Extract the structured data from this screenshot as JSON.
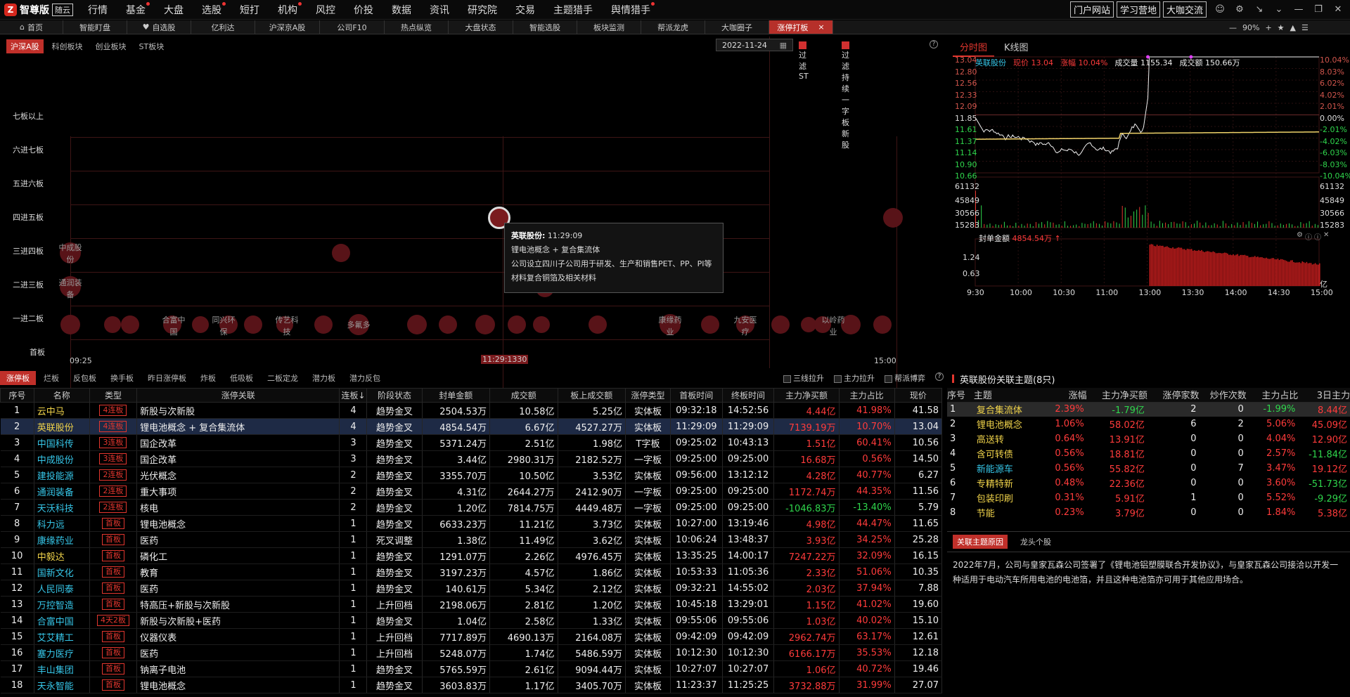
{
  "menubar": {
    "brand": "智尊版",
    "brand_tag": "随云",
    "items": [
      {
        "label": "行情",
        "dot": false
      },
      {
        "label": "基金",
        "dot": true
      },
      {
        "label": "大盘",
        "dot": false
      },
      {
        "label": "选股",
        "dot": true
      },
      {
        "label": "短打",
        "dot": false
      },
      {
        "label": "机构",
        "dot": true
      },
      {
        "label": "风控",
        "dot": false
      },
      {
        "label": "价投",
        "dot": false
      },
      {
        "label": "数据",
        "dot": false
      },
      {
        "label": "资讯",
        "dot": false
      },
      {
        "label": "研究院",
        "dot": false
      },
      {
        "label": "交易",
        "dot": false
      },
      {
        "label": "主题猎手",
        "dot": false
      },
      {
        "label": "舆情猎手",
        "dot": true
      }
    ],
    "right_buttons": [
      "门户网站",
      "学习营地",
      "大咖交流"
    ]
  },
  "tabs": [
    {
      "label": "首页",
      "icon": "home-icon",
      "active": false
    },
    {
      "label": "智能盯盘",
      "active": false
    },
    {
      "label": "自选股",
      "icon": "heart-icon",
      "active": false
    },
    {
      "label": "亿利达",
      "active": false
    },
    {
      "label": "沪深京A股",
      "active": false
    },
    {
      "label": "公司F10",
      "active": false
    },
    {
      "label": "热点纵览",
      "active": false
    },
    {
      "label": "大盘状态",
      "active": false
    },
    {
      "label": "智能选股",
      "active": false
    },
    {
      "label": "板块监测",
      "active": false
    },
    {
      "label": "帮派龙虎",
      "active": false
    },
    {
      "label": "大咖圈子",
      "active": false
    },
    {
      "label": "涨停打板",
      "active": true
    }
  ],
  "zoom": "90%",
  "limit_panel": {
    "tabs": [
      "沪深A股",
      "科创板块",
      "创业板块",
      "ST板块"
    ],
    "date": "2022-11-24",
    "filter_st": "过滤ST",
    "filter_one": "过滤持续一字板新股",
    "rows": [
      "七板以上",
      "六进七板",
      "五进六板",
      "四进五板",
      "三进四板",
      "二进三板",
      "一进二板",
      "首板"
    ],
    "bubble_names": [
      "中成股份",
      "通润装备",
      "合富中国",
      "同兴环保",
      "传艺科技",
      "多氟多",
      "康缘药业",
      "九安医疗",
      "以岭药业"
    ],
    "time_start": "09:25",
    "time_cursor": "11:29:13",
    "time_cursor_tail": "30",
    "time_end": "15:00",
    "tooltip": {
      "name": "英联股份:",
      "time": "11:29:09",
      "concept": "锂电池概念 + 复合集流体",
      "desc": "公司设立四川子公司用于研发、生产和销售PET、PP、PI等材料复合铜箔及相关材料"
    }
  },
  "table_tabs": [
    "涨停板",
    "烂板",
    "反包板",
    "换手板",
    "昨日涨停板",
    "炸板",
    "低吸板",
    "二板定龙",
    "潜力板",
    "潜力反包"
  ],
  "table_filters": [
    "三线拉升",
    "主力拉升",
    "帮派博弈"
  ],
  "table_headers": [
    "序号",
    "名称",
    "类型",
    "涨停关联",
    "连板↓",
    "阶段状态",
    "封单金额",
    "成交额",
    "板上成交额",
    "涨停类型",
    "首板时间",
    "终板时间",
    "主力净买额",
    "主力占比",
    "现价"
  ],
  "rows": [
    {
      "n": "1",
      "name": "云中马",
      "type": "4连板",
      "rel": "新股与次新股",
      "lb": "4",
      "stage": "趋势金叉",
      "fd": "2504.53万",
      "cje": "10.58亿",
      "bs": "5.25亿",
      "zt": "实体板",
      "t1": "09:32:18",
      "t2": "14:52:56",
      "jm": "4.44亿",
      "zb": "41.98%",
      "px": "41.58",
      "nc": "yl",
      "jc": "rd",
      "zc": "rd"
    },
    {
      "n": "2",
      "name": "英联股份",
      "type": "4连板",
      "rel": "锂电池概念 + 复合集流体",
      "lb": "4",
      "stage": "趋势金叉",
      "fd": "4854.54万",
      "cje": "6.67亿",
      "bs": "4527.27万",
      "zt": "实体板",
      "t1": "11:29:09",
      "t2": "11:29:09",
      "jm": "7139.19万",
      "zb": "10.70%",
      "px": "13.04",
      "nc": "yl",
      "jc": "rd",
      "zc": "rd",
      "sel": true
    },
    {
      "n": "3",
      "name": "中国科传",
      "type": "3连板",
      "rel": "国企改革",
      "lb": "3",
      "stage": "趋势金叉",
      "fd": "5371.24万",
      "cje": "2.51亿",
      "bs": "1.98亿",
      "zt": "T字板",
      "t1": "09:25:02",
      "t2": "10:43:13",
      "jm": "1.51亿",
      "zb": "60.41%",
      "px": "10.56",
      "nc": "cy",
      "jc": "rd",
      "zc": "rd"
    },
    {
      "n": "4",
      "name": "中成股份",
      "type": "3连板",
      "rel": "国企改革",
      "lb": "3",
      "stage": "趋势金叉",
      "fd": "3.44亿",
      "cje": "2980.31万",
      "bs": "2182.52万",
      "zt": "一字板",
      "t1": "09:25:00",
      "t2": "09:25:00",
      "jm": "16.68万",
      "zb": "0.56%",
      "px": "14.50",
      "nc": "cy",
      "jc": "rd",
      "zc": "rd"
    },
    {
      "n": "5",
      "name": "建投能源",
      "type": "2连板",
      "rel": "光伏概念",
      "lb": "2",
      "stage": "趋势金叉",
      "fd": "3355.70万",
      "cje": "10.50亿",
      "bs": "3.53亿",
      "zt": "实体板",
      "t1": "09:56:00",
      "t2": "13:12:12",
      "jm": "4.28亿",
      "zb": "40.77%",
      "px": "6.27",
      "nc": "cy",
      "jc": "rd",
      "zc": "rd"
    },
    {
      "n": "6",
      "name": "通润装备",
      "type": "2连板",
      "rel": "重大事项",
      "lb": "2",
      "stage": "趋势金叉",
      "fd": "4.31亿",
      "cje": "2644.27万",
      "bs": "2412.90万",
      "zt": "一字板",
      "t1": "09:25:00",
      "t2": "09:25:00",
      "jm": "1172.74万",
      "zb": "44.35%",
      "px": "11.56",
      "nc": "cy",
      "jc": "rd",
      "zc": "rd"
    },
    {
      "n": "7",
      "name": "天沃科技",
      "type": "2连板",
      "rel": "核电",
      "lb": "2",
      "stage": "趋势金叉",
      "fd": "1.20亿",
      "cje": "7814.75万",
      "bs": "4449.48万",
      "zt": "一字板",
      "t1": "09:25:00",
      "t2": "09:25:00",
      "jm": "-1046.83万",
      "zb": "-13.40%",
      "px": "5.79",
      "nc": "cy",
      "jc": "gr",
      "zc": "gr"
    },
    {
      "n": "8",
      "name": "科力远",
      "type": "首板",
      "rel": "锂电池概念",
      "lb": "1",
      "stage": "趋势金叉",
      "fd": "6633.23万",
      "cje": "11.21亿",
      "bs": "3.73亿",
      "zt": "实体板",
      "t1": "10:27:00",
      "t2": "13:19:46",
      "jm": "4.98亿",
      "zb": "44.47%",
      "px": "11.65",
      "nc": "cy",
      "jc": "rd",
      "zc": "rd"
    },
    {
      "n": "9",
      "name": "康缘药业",
      "type": "首板",
      "rel": "医药",
      "lb": "1",
      "stage": "死叉调整",
      "fd": "1.38亿",
      "cje": "11.49亿",
      "bs": "3.62亿",
      "zt": "实体板",
      "t1": "10:06:24",
      "t2": "13:48:37",
      "jm": "3.93亿",
      "zb": "34.25%",
      "px": "25.28",
      "nc": "cy",
      "jc": "rd",
      "zc": "rd"
    },
    {
      "n": "10",
      "name": "中毅达",
      "type": "首板",
      "rel": "磷化工",
      "lb": "1",
      "stage": "趋势金叉",
      "fd": "1291.07万",
      "cje": "2.26亿",
      "bs": "4976.45万",
      "zt": "实体板",
      "t1": "13:35:25",
      "t2": "14:00:17",
      "jm": "7247.22万",
      "zb": "32.09%",
      "px": "16.15",
      "nc": "yl",
      "jc": "rd",
      "zc": "rd"
    },
    {
      "n": "11",
      "name": "国新文化",
      "type": "首板",
      "rel": "教育",
      "lb": "1",
      "stage": "趋势金叉",
      "fd": "3197.23万",
      "cje": "4.57亿",
      "bs": "1.86亿",
      "zt": "实体板",
      "t1": "10:53:33",
      "t2": "11:05:36",
      "jm": "2.33亿",
      "zb": "51.06%",
      "px": "10.35",
      "nc": "cy",
      "jc": "rd",
      "zc": "rd"
    },
    {
      "n": "12",
      "name": "人民同泰",
      "type": "首板",
      "rel": "医药",
      "lb": "1",
      "stage": "趋势金叉",
      "fd": "140.61万",
      "cje": "5.34亿",
      "bs": "2.12亿",
      "zt": "实体板",
      "t1": "09:32:21",
      "t2": "14:55:02",
      "jm": "2.03亿",
      "zb": "37.94%",
      "px": "7.88",
      "nc": "cy",
      "jc": "rd",
      "zc": "rd"
    },
    {
      "n": "13",
      "name": "万控智造",
      "type": "首板",
      "rel": "特高压+新股与次新股",
      "lb": "1",
      "stage": "上升回档",
      "fd": "2198.06万",
      "cje": "2.81亿",
      "bs": "1.20亿",
      "zt": "实体板",
      "t1": "10:45:18",
      "t2": "13:29:01",
      "jm": "1.15亿",
      "zb": "41.02%",
      "px": "19.60",
      "nc": "cy",
      "jc": "rd",
      "zc": "rd"
    },
    {
      "n": "14",
      "name": "合富中国",
      "type": "4天2板",
      "rel": "新股与次新股+医药",
      "lb": "1",
      "stage": "趋势金叉",
      "fd": "1.04亿",
      "cje": "2.58亿",
      "bs": "1.33亿",
      "zt": "实体板",
      "t1": "09:55:06",
      "t2": "09:55:06",
      "jm": "1.03亿",
      "zb": "40.02%",
      "px": "15.10",
      "nc": "cy",
      "jc": "rd",
      "zc": "rd"
    },
    {
      "n": "15",
      "name": "艾艾精工",
      "type": "首板",
      "rel": "仪器仪表",
      "lb": "1",
      "stage": "上升回档",
      "fd": "7717.89万",
      "cje": "4690.13万",
      "bs": "2164.08万",
      "zt": "实体板",
      "t1": "09:42:09",
      "t2": "09:42:09",
      "jm": "2962.74万",
      "zb": "63.17%",
      "px": "12.61",
      "nc": "cy",
      "jc": "rd",
      "zc": "rd"
    },
    {
      "n": "16",
      "name": "塞力医疗",
      "type": "首板",
      "rel": "医药",
      "lb": "1",
      "stage": "上升回档",
      "fd": "5248.07万",
      "cje": "1.74亿",
      "bs": "5486.59万",
      "zt": "实体板",
      "t1": "10:12:30",
      "t2": "10:12:30",
      "jm": "6166.17万",
      "zb": "35.53%",
      "px": "12.18",
      "nc": "cy",
      "jc": "rd",
      "zc": "rd"
    },
    {
      "n": "17",
      "name": "丰山集团",
      "type": "首板",
      "rel": "钠离子电池",
      "lb": "1",
      "stage": "趋势金叉",
      "fd": "5765.59万",
      "cje": "2.61亿",
      "bs": "9094.44万",
      "zt": "实体板",
      "t1": "10:27:07",
      "t2": "10:27:07",
      "jm": "1.06亿",
      "zb": "40.72%",
      "px": "19.46",
      "nc": "cy",
      "jc": "rd",
      "zc": "rd"
    },
    {
      "n": "18",
      "name": "天永智能",
      "type": "首板",
      "rel": "锂电池概念",
      "lb": "1",
      "stage": "趋势金叉",
      "fd": "3603.83万",
      "cje": "1.17亿",
      "bs": "3405.70万",
      "zt": "实体板",
      "t1": "11:23:37",
      "t2": "11:25:25",
      "jm": "3732.88万",
      "zb": "31.99%",
      "px": "27.07",
      "nc": "cy",
      "jc": "rd",
      "zc": "rd"
    }
  ],
  "right_chart": {
    "tabs": [
      "分时图",
      "K线图"
    ],
    "info": {
      "name": "英联股份",
      "price_label": "现价",
      "price": "13.04",
      "chg_label": "涨幅",
      "chg": "10.04%",
      "vol_label": "成交量",
      "vol": "1155.34",
      "amt_label": "成交额",
      "amt": "150.66万"
    },
    "y_prices": [
      "13.04",
      "12.80",
      "12.56",
      "12.33",
      "12.09",
      "11.85",
      "11.61",
      "11.37",
      "11.14",
      "10.90",
      "10.66"
    ],
    "y_pcts": [
      "10.04%",
      "8.03%",
      "6.02%",
      "4.02%",
      "2.01%",
      "0.00%",
      "-2.01%",
      "-4.02%",
      "-6.03%",
      "-8.03%",
      "-10.04%"
    ],
    "vol_labels": [
      "61132",
      "45849",
      "30566",
      "15283"
    ],
    "fd_label": "封单金额",
    "fd_value": "4854.54万",
    "fd_axis": [
      "1.24",
      "0.63"
    ],
    "fd_unit": "亿",
    "x_labels": [
      "9:30",
      "10:00",
      "10:30",
      "11:00",
      "13:00",
      "13:30",
      "14:00",
      "14:30",
      "15:00"
    ]
  },
  "theme_panel": {
    "title": "英联股份关联主题(8只)",
    "headers": [
      "序号",
      "主题",
      "涨幅",
      "主力净买额",
      "涨停家数",
      "炒作次数",
      "主力占比",
      "3日主力"
    ],
    "rows": [
      {
        "n": "1",
        "name": "复合集流体",
        "zf": "2.39%",
        "jm": "-1.79亿",
        "zt": "2",
        "cz": "0",
        "zb": "-1.99%",
        "d3": "8.44亿",
        "nc": "yl",
        "jc": "gr",
        "zc": "gr",
        "dc": "rd",
        "sel": true
      },
      {
        "n": "2",
        "name": "锂电池概念",
        "zf": "1.06%",
        "jm": "58.02亿",
        "zt": "6",
        "cz": "2",
        "zb": "5.06%",
        "d3": "45.09亿",
        "nc": "yl",
        "jc": "rd",
        "zc": "rd",
        "dc": "rd"
      },
      {
        "n": "3",
        "name": "高送转",
        "zf": "0.64%",
        "jm": "13.91亿",
        "zt": "0",
        "cz": "0",
        "zb": "4.04%",
        "d3": "12.90亿",
        "nc": "yl",
        "jc": "rd",
        "zc": "rd",
        "dc": "rd"
      },
      {
        "n": "4",
        "name": "含可转债",
        "zf": "0.56%",
        "jm": "18.81亿",
        "zt": "0",
        "cz": "0",
        "zb": "2.57%",
        "d3": "-11.84亿",
        "nc": "yl",
        "jc": "rd",
        "zc": "rd",
        "dc": "gr"
      },
      {
        "n": "5",
        "name": "新能源车",
        "zf": "0.56%",
        "jm": "55.82亿",
        "zt": "0",
        "cz": "7",
        "zb": "3.47%",
        "d3": "19.12亿",
        "nc": "cy",
        "jc": "rd",
        "zc": "rd",
        "dc": "rd"
      },
      {
        "n": "6",
        "name": "专精特新",
        "zf": "0.48%",
        "jm": "22.36亿",
        "zt": "0",
        "cz": "0",
        "zb": "3.60%",
        "d3": "-51.73亿",
        "nc": "yl",
        "jc": "rd",
        "zc": "rd",
        "dc": "gr"
      },
      {
        "n": "7",
        "name": "包装印刷",
        "zf": "0.31%",
        "jm": "5.91亿",
        "zt": "1",
        "cz": "0",
        "zb": "5.52%",
        "d3": "-9.29亿",
        "nc": "yl",
        "jc": "rd",
        "zc": "rd",
        "dc": "gr"
      },
      {
        "n": "8",
        "name": "节能",
        "zf": "0.23%",
        "jm": "3.79亿",
        "zt": "0",
        "cz": "0",
        "zb": "1.84%",
        "d3": "5.38亿",
        "nc": "yl",
        "jc": "rd",
        "zc": "rd",
        "dc": "rd"
      }
    ],
    "reason_tabs": [
      "关联主题原因",
      "龙头个股"
    ],
    "reason_text": "2022年7月，公司与皇家瓦森公司签署了《锂电池铝塑膜联合开发协议》，与皇家瓦森公司接洽以开发一种适用于电动汽车所用电池的电池箔，并且这种电池箔亦可用于其他应用场合。"
  }
}
